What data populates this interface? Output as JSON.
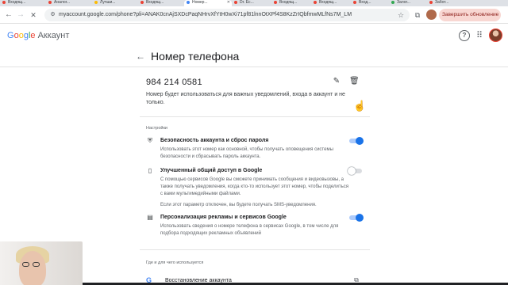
{
  "browser": {
    "tabs": [
      {
        "label": "Входящ...",
        "color": "#ea4335",
        "active": false
      },
      {
        "label": "Аналог...",
        "color": "#ea4335",
        "active": false
      },
      {
        "label": "Лучши...",
        "color": "#fbbc05",
        "active": false
      },
      {
        "label": "Входящ...",
        "color": "#ea4335",
        "active": false
      },
      {
        "label": "Номер...",
        "color": "#4285f4",
        "active": true
      },
      {
        "label": "Dr. Ес...",
        "color": "#ea4335",
        "active": false
      },
      {
        "label": "Входящ...",
        "color": "#ea4335",
        "active": false
      },
      {
        "label": "Входящ...",
        "color": "#ea4335",
        "active": false
      },
      {
        "label": "Вход...",
        "color": "#ea4335",
        "active": false
      },
      {
        "label": "Залог...",
        "color": "#34a853",
        "active": false
      },
      {
        "label": "Забот...",
        "color": "#ea4335",
        "active": false
      }
    ],
    "url": "myaccount.google.com/phone?pli=ANAK0cnAjSXDcPaqNHrvXfYtH0wXi71pf81lnnOtXPf4S8KzZrIQbfmwMLfNs7M_LM",
    "update_button": "Завершить обновление"
  },
  "app": {
    "logo_google": [
      "G",
      "o",
      "o",
      "g",
      "l",
      "e"
    ],
    "logo_account": "Аккаунт"
  },
  "page": {
    "title": "Номер телефона",
    "phone_number": "984 214 0581",
    "description": "Номер будет использоваться для важных уведомлений, входа в аккаунт и не только."
  },
  "settings": {
    "label": "Настройки",
    "items": [
      {
        "icon": "shield-icon",
        "title": "Безопасность аккаунта и сброс пароля",
        "description": "Использовать этот номер как основной, чтобы получать оповещения системы безопасности и сбрасывать пароль аккаунта.",
        "enabled": true
      },
      {
        "icon": "phone-icon",
        "title": "Улучшенный общий доступ в Google",
        "description": "С помощью сервисов Google вы сможете принимать сообщения и видеовызовы, а также получать уведомления, когда кто-то использует этот номер, чтобы поделиться с вами мультимедийными файлами.",
        "note": "Если этот параметр отключен, вы будете получать SMS-уведомления.",
        "enabled": false
      },
      {
        "icon": "ad-icon",
        "title": "Персонализация рекламы и сервисов Google",
        "description": "Использовать сведения о номере телефона в сервисах Google, в том числе для подбора подходящих рекламных объявлений",
        "enabled": true
      }
    ]
  },
  "usage": {
    "label": "Где и для чего используется",
    "first_item": "Восстановление аккаунта",
    "first_icon_letter": "G"
  }
}
